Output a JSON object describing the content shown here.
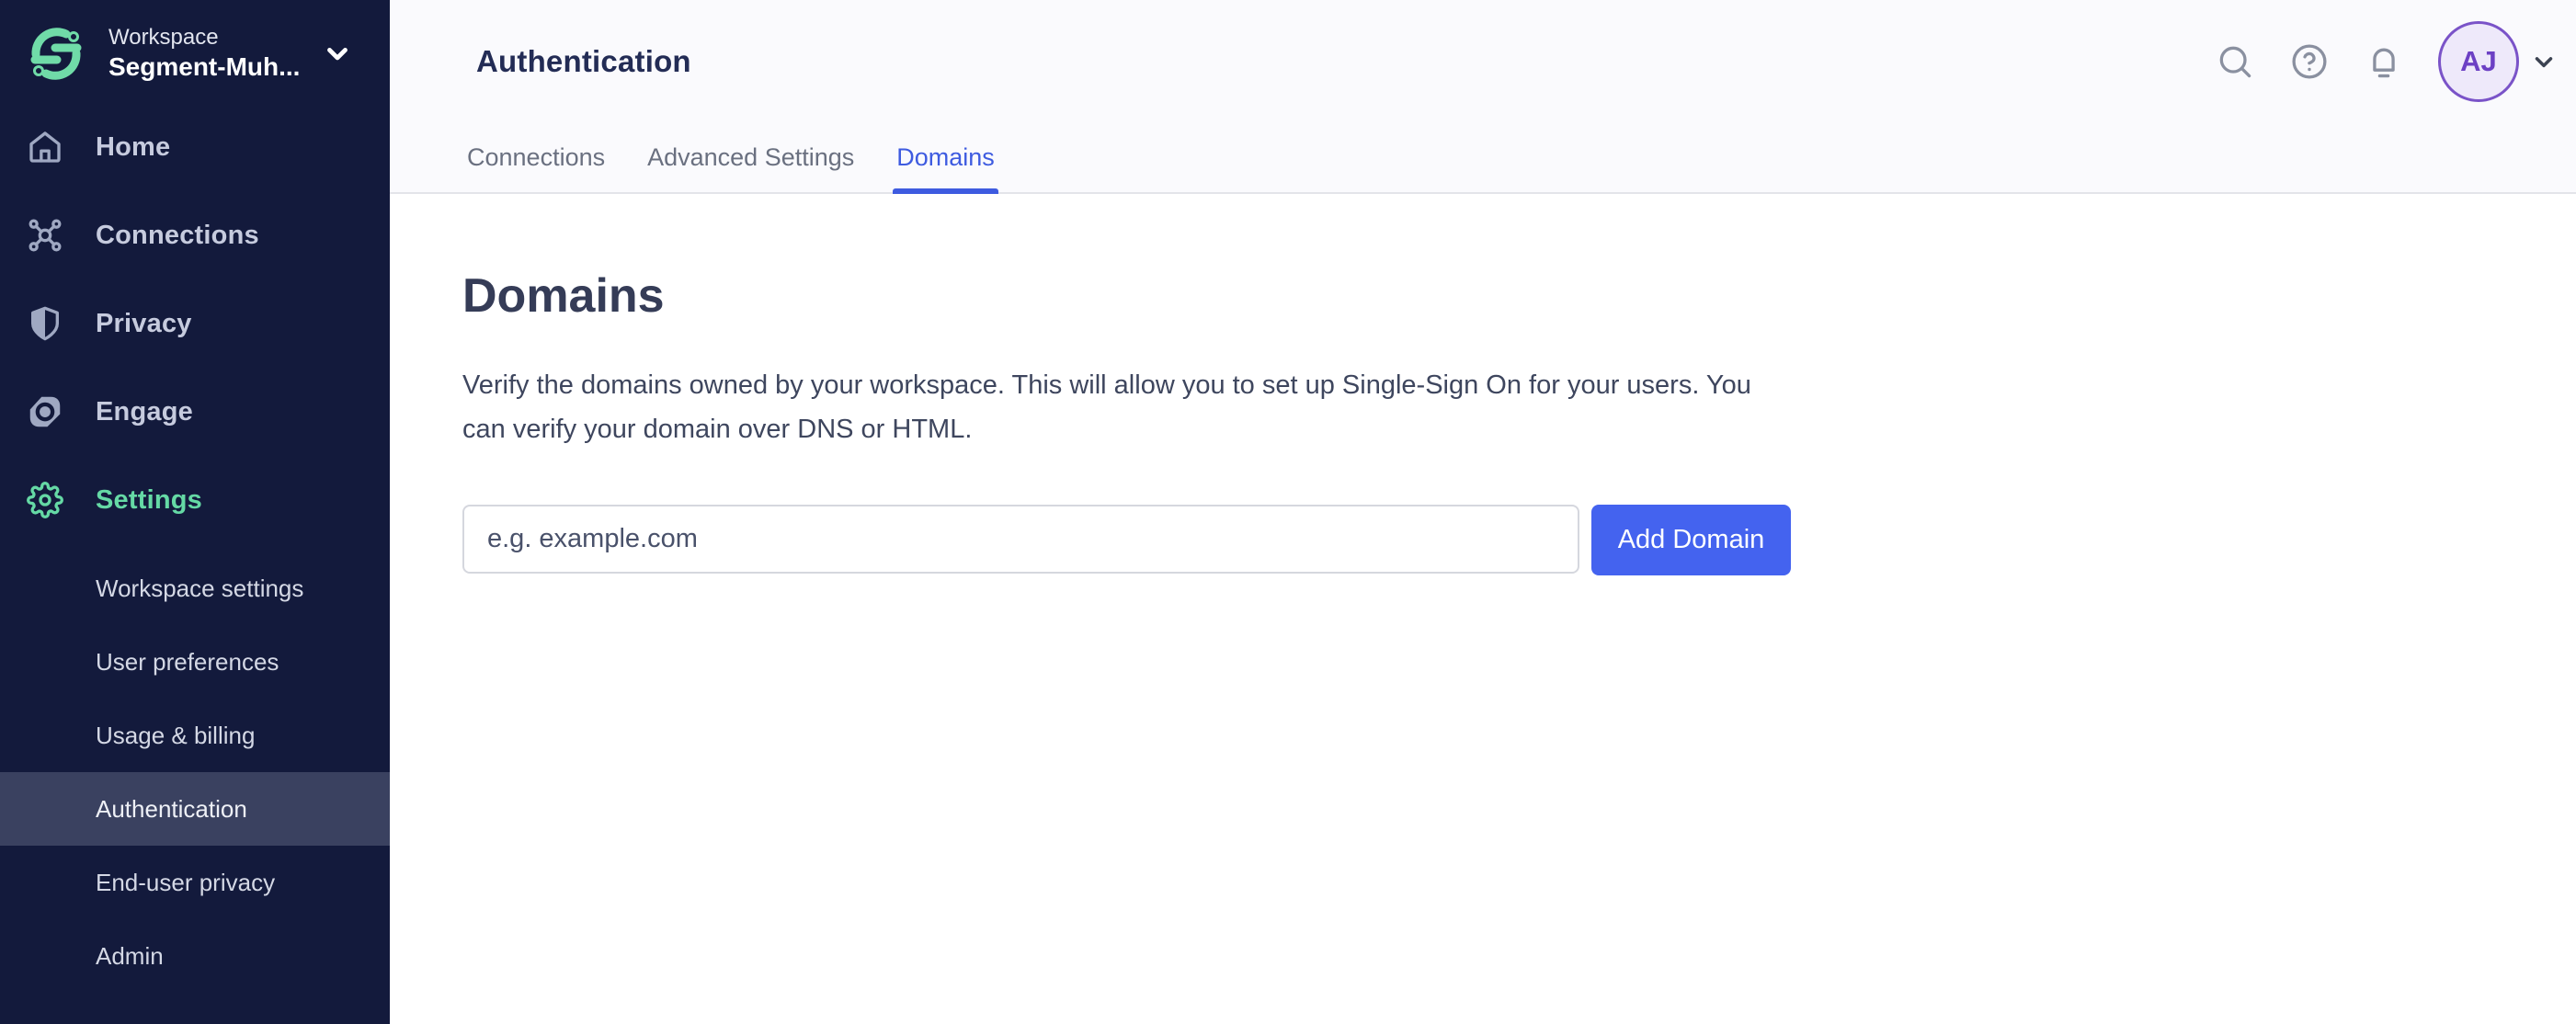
{
  "workspace": {
    "label": "Workspace",
    "name": "Segment-Muh..."
  },
  "sidebar": {
    "items": [
      {
        "label": "Home",
        "icon": "home-icon",
        "active": false
      },
      {
        "label": "Connections",
        "icon": "connections-icon",
        "active": false
      },
      {
        "label": "Privacy",
        "icon": "shield-icon",
        "active": false
      },
      {
        "label": "Engage",
        "icon": "engage-icon",
        "active": false
      },
      {
        "label": "Settings",
        "icon": "gear-icon",
        "active": true
      }
    ],
    "settings_items": [
      {
        "label": "Workspace settings",
        "selected": false
      },
      {
        "label": "User preferences",
        "selected": false
      },
      {
        "label": "Usage & billing",
        "selected": false
      },
      {
        "label": "Authentication",
        "selected": true
      },
      {
        "label": "End-user privacy",
        "selected": false
      },
      {
        "label": "Admin",
        "selected": false
      }
    ]
  },
  "header": {
    "title": "Authentication",
    "tabs": [
      {
        "label": "Connections",
        "active": false
      },
      {
        "label": "Advanced Settings",
        "active": false
      },
      {
        "label": "Domains",
        "active": true
      }
    ],
    "actions": {
      "icons": [
        "search-icon",
        "help-icon",
        "bell-icon"
      ],
      "avatar_initials": "AJ"
    }
  },
  "main": {
    "heading": "Domains",
    "description": "Verify the domains owned by your workspace. This will allow you to set up Single-Sign On for your users. You can verify your domain over DNS or HTML.",
    "domain_input": {
      "value": "",
      "placeholder": "e.g. example.com"
    },
    "add_button_label": "Add Domain"
  },
  "colors": {
    "sidebar_bg": "#131A3C",
    "accent_green": "#65D9A5",
    "tab_active_blue": "#3E5BE0",
    "button_blue": "#4463EF",
    "avatar_purple": "#7A53C8",
    "selected_row_bg": "#3A4160"
  }
}
